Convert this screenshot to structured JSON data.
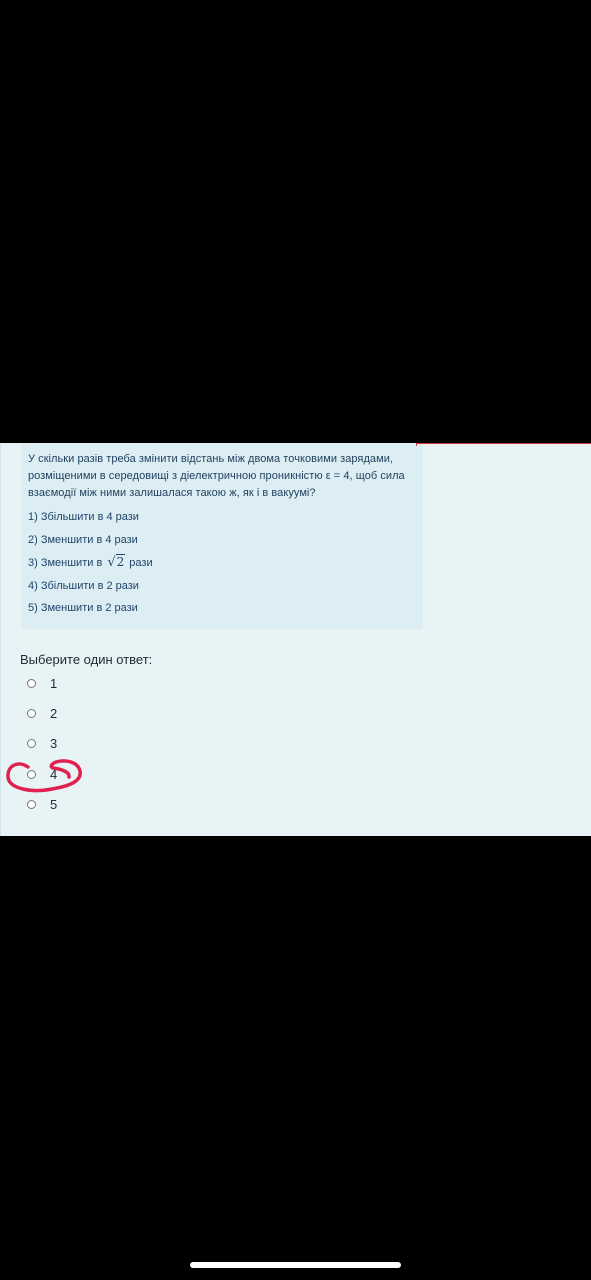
{
  "question": {
    "text": "У скільки разів треба змінити відстань між двома точковими зарядами, розміщеними в середовищі з діелектричною проникністю ε = 4, щоб сила взаємодії між ними залишалася такою ж, як і в вакуумі?",
    "options": [
      "1) Збільшити в 4 рази",
      "2) Зменшити в 4 рази",
      "3) Зменшити в",
      "4) Збільшити в 2 рази",
      "5) Зменшити в 2 рази"
    ],
    "option3_sqrt": "√",
    "option3_radicand": "2",
    "option3_suffix": "рази"
  },
  "answer": {
    "prompt": "Выберите один ответ:",
    "choices": [
      "1",
      "2",
      "3",
      "4",
      "5"
    ],
    "selected": null
  },
  "annotation": {
    "marked_choice": "4",
    "color": "#e0214e"
  },
  "colors": {
    "panel_background": "#e7f3f5",
    "question_background": "#dcedf4",
    "text": "#1f3f5c"
  }
}
